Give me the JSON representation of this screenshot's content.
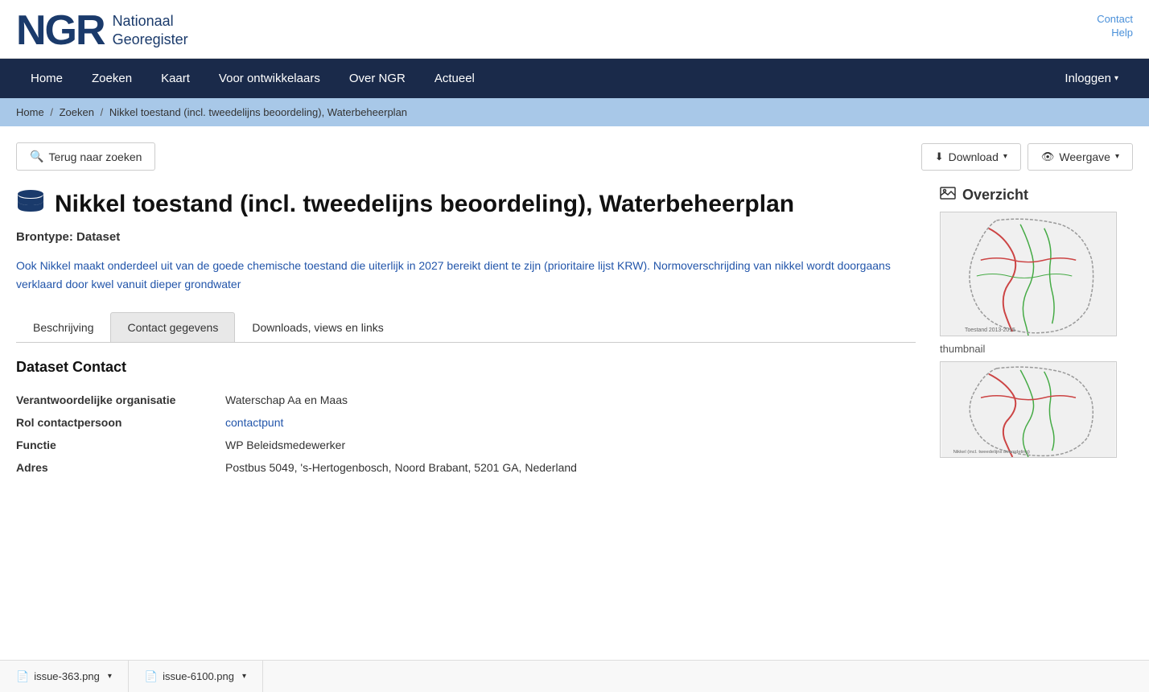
{
  "site": {
    "logo_ngr": "NGR",
    "logo_text_line1": "Nationaal",
    "logo_text_line2": "Georegister"
  },
  "top_links": {
    "contact": "Contact",
    "help": "Help"
  },
  "nav": {
    "items": [
      {
        "label": "Home",
        "id": "home"
      },
      {
        "label": "Zoeken",
        "id": "zoeken"
      },
      {
        "label": "Kaart",
        "id": "kaart"
      },
      {
        "label": "Voor ontwikkelaars",
        "id": "voor-ontwikkelaars"
      },
      {
        "label": "Over NGR",
        "id": "over-ngr"
      },
      {
        "label": "Actueel",
        "id": "actueel"
      }
    ],
    "login_label": "Inloggen"
  },
  "breadcrumb": {
    "items": [
      {
        "label": "Home",
        "href": "#"
      },
      {
        "label": "Zoeken",
        "href": "#"
      },
      {
        "label": "Nikkel toestand (incl. tweedelijns beoordeling), Waterbeheerplan",
        "href": "#"
      }
    ]
  },
  "toolbar": {
    "back_label": "Terug naar zoeken",
    "download_label": "Download",
    "weergave_label": "Weergave"
  },
  "page": {
    "title": "Nikkel toestand (incl. tweedelijns beoordeling), Waterbeheerplan",
    "brontype_label": "Brontype:",
    "brontype_value": "Dataset",
    "description": "Ook Nikkel maakt onderdeel uit van de goede chemische toestand die uiterlijk in 2027 bereikt dient te zijn (prioritaire lijst KRW). Normoverschrijding van nikkel wordt doorgaans verklaard door kwel vanuit dieper grondwater"
  },
  "tabs": [
    {
      "label": "Beschrijving",
      "id": "beschrijving"
    },
    {
      "label": "Contact gegevens",
      "id": "contact-gegevens",
      "active": true
    },
    {
      "label": "Downloads, views en links",
      "id": "downloads-views-links"
    }
  ],
  "contact_section": {
    "title": "Dataset Contact",
    "fields": [
      {
        "label": "Verantwoordelijke organisatie",
        "value": "Waterschap Aa en Maas",
        "is_link": false
      },
      {
        "label": "Rol contactpersoon",
        "value": "contactpunt",
        "is_link": true
      },
      {
        "label": "Functie",
        "value": "WP Beleidsmedewerker",
        "is_link": false
      },
      {
        "label": "Adres",
        "value": "Postbus 5049, 's-Hertogenbosch, Noord Brabant, 5201 GA, Nederland",
        "is_link": false
      }
    ]
  },
  "sidebar": {
    "title": "Overzicht",
    "thumbnail_label": "thumbnail"
  },
  "bottom_tabs": [
    {
      "label": "issue-363.png",
      "id": "issue-363"
    },
    {
      "label": "issue-6100.png",
      "id": "issue-6100"
    }
  ]
}
